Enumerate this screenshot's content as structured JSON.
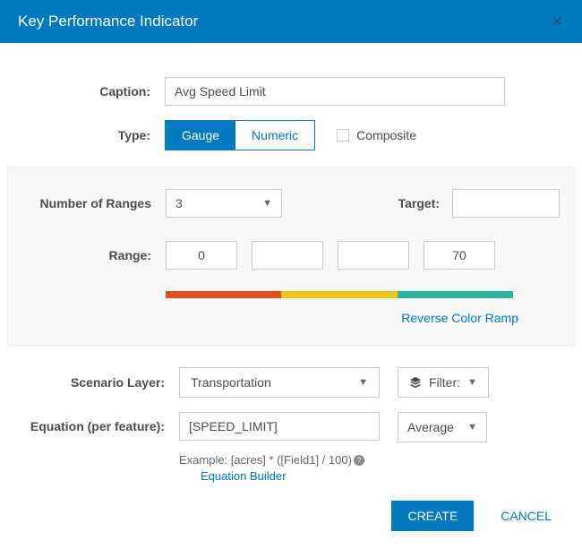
{
  "header": {
    "title": "Key Performance Indicator"
  },
  "caption": {
    "label": "Caption:",
    "value": "Avg Speed Limit"
  },
  "type": {
    "label": "Type:",
    "gauge": "Gauge",
    "numeric": "Numeric",
    "composite": "Composite"
  },
  "ranges": {
    "numLabel": "Number of Ranges",
    "numValue": "3",
    "targetLabel": "Target:",
    "targetValue": "",
    "rangeLabel": "Range:",
    "values": [
      "0",
      "",
      "",
      "70"
    ],
    "colors": [
      "#e04f1d",
      "#efc61a",
      "#2eb39c"
    ],
    "reverse": "Reverse Color Ramp"
  },
  "scenario": {
    "label": "Scenario Layer:",
    "value": "Transportation",
    "filter": "Filter:"
  },
  "equation": {
    "label": "Equation (per feature):",
    "value": "[SPEED_LIMIT]",
    "agg": "Average",
    "example": "Example: [acres] * ([Field1] / 100)",
    "builder": "Equation Builder"
  },
  "footer": {
    "create": "CREATE",
    "cancel": "CANCEL"
  }
}
